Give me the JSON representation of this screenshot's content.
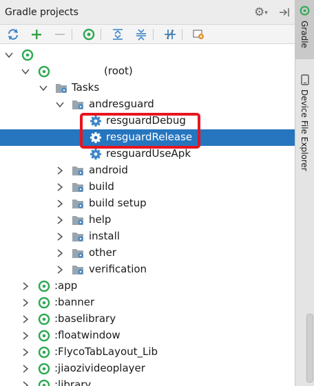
{
  "panel": {
    "title": "Gradle projects"
  },
  "toolbar": {
    "refresh": "refresh-icon",
    "add": "add-icon",
    "remove": "remove-icon",
    "execute": "gradle-execute-icon",
    "expand_all": "expand-all-icon",
    "collapse_all": "collapse-all-icon",
    "toggle_offline": "offline-mode-icon",
    "settings": "gradle-settings-icon"
  },
  "tree": {
    "root_project": {
      "name": "",
      "suffix": "(root)"
    },
    "tasks_label": "Tasks",
    "andresguard": "andresguard",
    "tasks": [
      "resguardDebug",
      "resguardRelease",
      "resguardUseApk"
    ],
    "groups": [
      "android",
      "build",
      "build setup",
      "help",
      "install",
      "other",
      "verification"
    ],
    "modules": [
      ":app",
      ":banner",
      ":baselibrary",
      ":floatwindow",
      ":FlycoTabLayout_Lib",
      ":jiaozivideoplayer",
      ":library"
    ]
  },
  "sidebar": {
    "gradle_tab": "Gradle",
    "device_explorer_tab": "Device File Explorer"
  },
  "colors": {
    "selection": "#2675bf",
    "annotation": "#e8141f",
    "gradle_green": "#2faa54"
  }
}
